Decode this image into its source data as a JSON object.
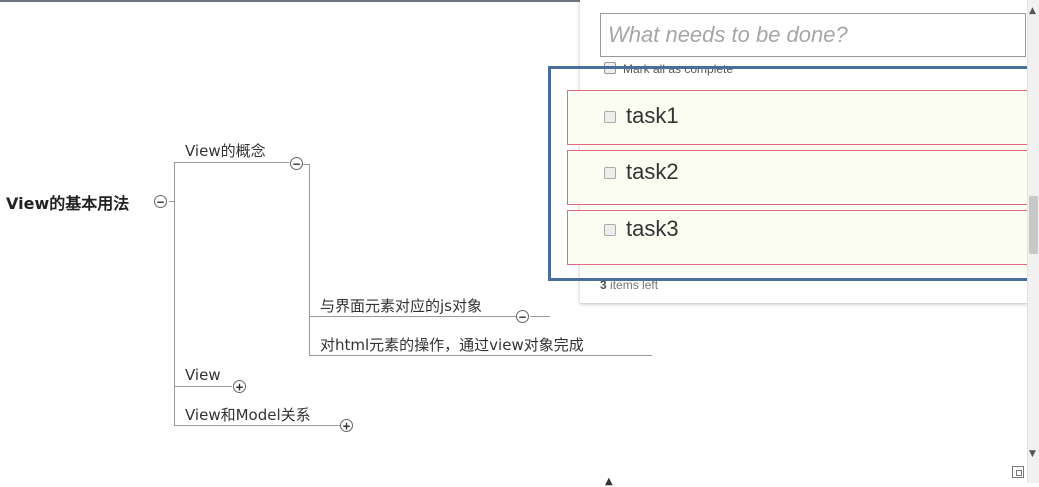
{
  "mindmap": {
    "root": "View的基本用法",
    "branches": [
      {
        "label": "View的概念",
        "toggle": "−"
      },
      {
        "label": "View",
        "toggle": "+"
      },
      {
        "label": "View和Model关系",
        "toggle": "+"
      }
    ],
    "concept_children": [
      {
        "label": "与界面元素对应的js对象",
        "toggle": "−"
      },
      {
        "label": "对html元素的操作，通过view对象完成"
      }
    ],
    "root_toggle": "−"
  },
  "todo": {
    "placeholder": "What needs to be done?",
    "mark_all_label": "Mark all as complete",
    "items": [
      {
        "label": "task1",
        "completed": false
      },
      {
        "label": "task2",
        "completed": false
      },
      {
        "label": "task3",
        "completed": false
      }
    ],
    "footer": {
      "count": "3",
      "text": "items left"
    }
  },
  "colors": {
    "item_border": "#e06b80",
    "selection_border": "#4a6e9c",
    "list_background": "#fbfcf2"
  }
}
